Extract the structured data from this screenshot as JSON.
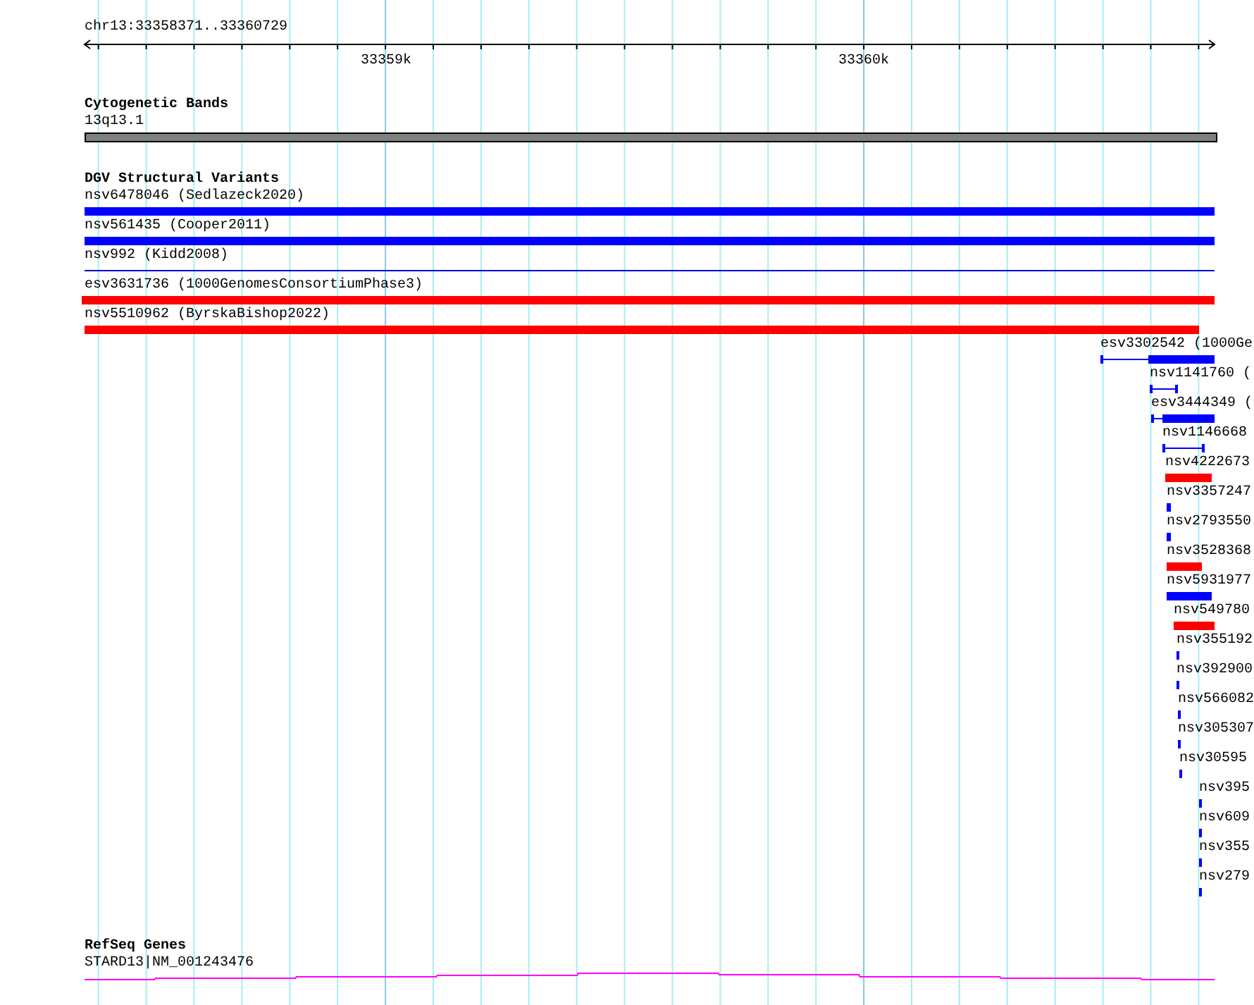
{
  "ruler": {
    "region": "chr13:33358371..33360729",
    "ticks": [
      {
        "label": "33359k"
      },
      {
        "label": "33360k"
      }
    ]
  },
  "cytogenetic_bands": {
    "title": "Cytogenetic Bands",
    "band": "13q13.1"
  },
  "dgv_structural_variants": {
    "title": "DGV Structural Variants",
    "features": [
      {
        "label": "nsv6478046 (Sedlazeck2020)",
        "kind": "bar",
        "color": "#0000ff"
      },
      {
        "label": "nsv561435 (Cooper2011)",
        "kind": "bar",
        "color": "#0000ff"
      },
      {
        "label": "nsv992 (Kidd2008)",
        "kind": "line",
        "color": "#0000cc"
      },
      {
        "label": "esv3631736 (1000GenomesConsortiumPhase3)",
        "kind": "bar",
        "color": "#ff0000"
      },
      {
        "label": "nsv5510962 (ByrskaBishop2022)",
        "kind": "bar",
        "color": "#ff0000"
      },
      {
        "label": "esv3302542 (1000Ge",
        "kind": "split",
        "color": "#0000ff"
      },
      {
        "label": "nsv1141760 (",
        "kind": "capped",
        "color": "#0000ff"
      },
      {
        "label": "esv3444349 (",
        "kind": "split",
        "color": "#0000ff"
      },
      {
        "label": "nsv1146668",
        "kind": "capped",
        "color": "#0000ff"
      },
      {
        "label": "nsv4222673",
        "kind": "bar",
        "color": "#ff0000"
      },
      {
        "label": "nsv3357247",
        "kind": "bar",
        "color": "#0000ff"
      },
      {
        "label": "nsv2793550",
        "kind": "bar",
        "color": "#0000ff"
      },
      {
        "label": "nsv3528368",
        "kind": "bar",
        "color": "#ff0000"
      },
      {
        "label": "nsv5931977",
        "kind": "bar",
        "color": "#0000ff"
      },
      {
        "label": "nsv549780",
        "kind": "bar",
        "color": "#ff0000"
      },
      {
        "label": "nsv355192",
        "kind": "bar",
        "color": "#0000ff"
      },
      {
        "label": "nsv392900",
        "kind": "bar",
        "color": "#0000ff"
      },
      {
        "label": "nsv566082",
        "kind": "bar",
        "color": "#0000ff"
      },
      {
        "label": "nsv305307",
        "kind": "bar",
        "color": "#0000ff"
      },
      {
        "label": "nsv30595",
        "kind": "bar",
        "color": "#0000ff"
      },
      {
        "label": "nsv395",
        "kind": "bar",
        "color": "#0000ff"
      },
      {
        "label": "nsv609",
        "kind": "bar",
        "color": "#0000ff"
      },
      {
        "label": "nsv355",
        "kind": "bar",
        "color": "#0000ff"
      },
      {
        "label": "nsv279",
        "kind": "bar",
        "color": "#0000ff"
      }
    ]
  },
  "refseq_genes": {
    "title": "RefSeq Genes",
    "gene": "STARD13|NM_001243476"
  }
}
